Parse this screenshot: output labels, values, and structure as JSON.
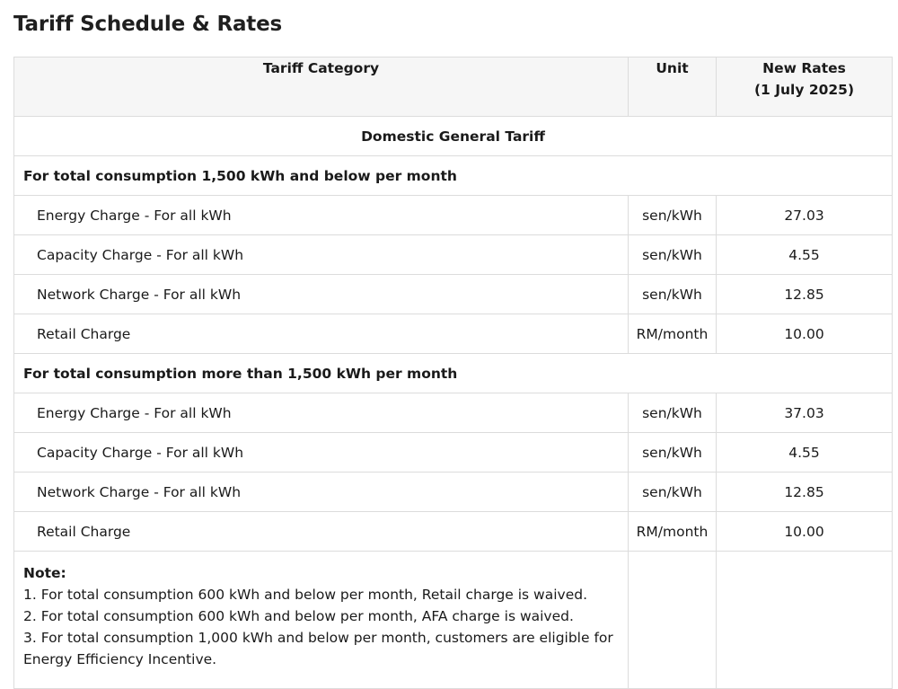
{
  "page": {
    "title": "Tariff Schedule & Rates"
  },
  "table": {
    "headers": {
      "category": "Tariff Category",
      "unit": "Unit",
      "rates_line1": "New Rates",
      "rates_line2": "(1 July 2025)"
    },
    "section_title": "Domestic General Tariff",
    "groups": [
      {
        "title": "For total consumption 1,500 kWh and below per month",
        "rows": [
          {
            "category": "Energy Charge - For all kWh",
            "unit": "sen/kWh",
            "rate": "27.03"
          },
          {
            "category": "Capacity Charge - For all kWh",
            "unit": "sen/kWh",
            "rate": "4.55"
          },
          {
            "category": "Network Charge - For all kWh",
            "unit": "sen/kWh",
            "rate": "12.85"
          },
          {
            "category": "Retail Charge",
            "unit": "RM/month",
            "rate": "10.00"
          }
        ]
      },
      {
        "title": "For total consumption more than 1,500 kWh per month",
        "rows": [
          {
            "category": "Energy Charge - For all kWh",
            "unit": "sen/kWh",
            "rate": "37.03"
          },
          {
            "category": "Capacity Charge - For all kWh",
            "unit": "sen/kWh",
            "rate": "4.55"
          },
          {
            "category": "Network Charge - For all kWh",
            "unit": "sen/kWh",
            "rate": "12.85"
          },
          {
            "category": "Retail Charge",
            "unit": "RM/month",
            "rate": "10.00"
          }
        ]
      }
    ],
    "notes": {
      "title": "Note:",
      "lines": [
        "1. For total consumption 600 kWh and below per month, Retail charge is waived.",
        "2. For total consumption 600 kWh and below per month, AFA charge is waived.",
        "3. For total consumption 1,000 kWh and below per month, customers are eligible for Energy Efficiency Incentive."
      ]
    }
  }
}
